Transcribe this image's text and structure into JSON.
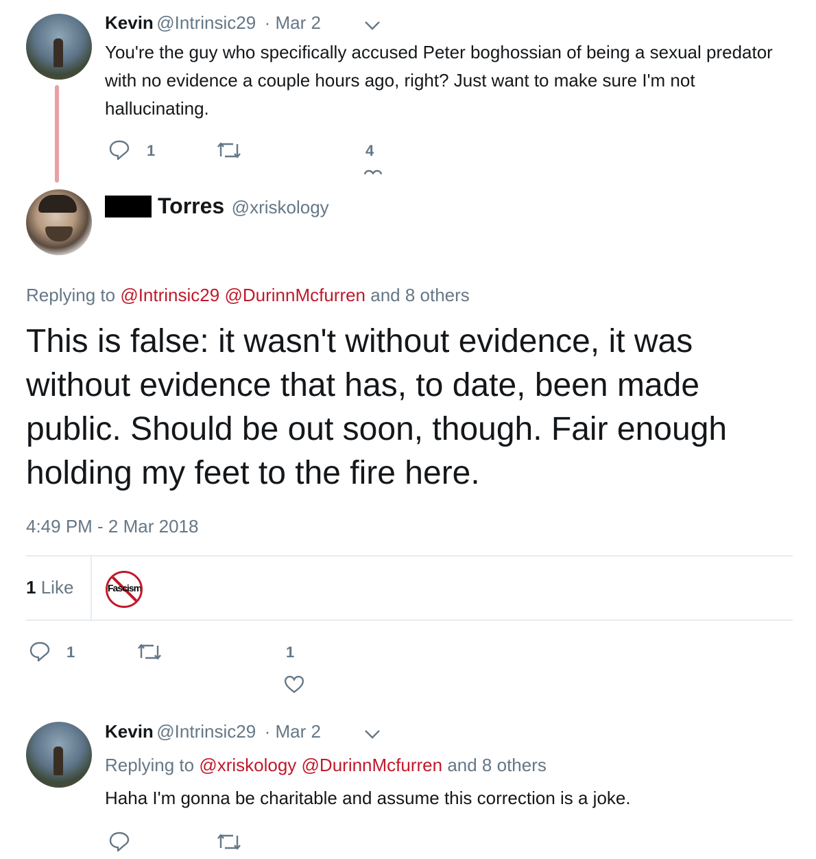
{
  "tweet1": {
    "name": "Kevin",
    "handle": "@Intrinsic29",
    "date": "· Mar 2",
    "text": "You're the guy who specifically accused Peter boghossian of being a sexual predator with no evidence a couple hours ago, right? Just want to make sure I'm not hallucinating.",
    "reply_count": "1",
    "like_count": "4"
  },
  "main_tweet": {
    "name": "Torres",
    "handle": "@xriskology",
    "replying_prefix": "Replying to",
    "replying_user1": "@Intrinsic29",
    "replying_user2": "@DurinnMcfurren",
    "replying_suffix": "and 8 others",
    "text": "This is false: it wasn't without evidence, it was without evidence that has, to date, been made public. Should be out soon, though. Fair enough holding my feet to the fire here.",
    "timestamp": "4:49 PM - 2 Mar 2018",
    "likes_number": "1",
    "likes_label": "Like",
    "liker_badge_text": "Fascism",
    "reply_count": "1",
    "like_count": "1"
  },
  "tweet3": {
    "name": "Kevin",
    "handle": "@Intrinsic29",
    "date": "· Mar 2",
    "replying_prefix": "Replying to",
    "replying_user1": "@xriskology",
    "replying_user2": "@DurinnMcfurren",
    "replying_suffix": "and 8 others",
    "text": "Haha I'm gonna be charitable and assume this correction is a joke."
  },
  "colors": {
    "link": "#c0192a",
    "muted": "#657786",
    "thread_line": "#e8a0a6"
  }
}
